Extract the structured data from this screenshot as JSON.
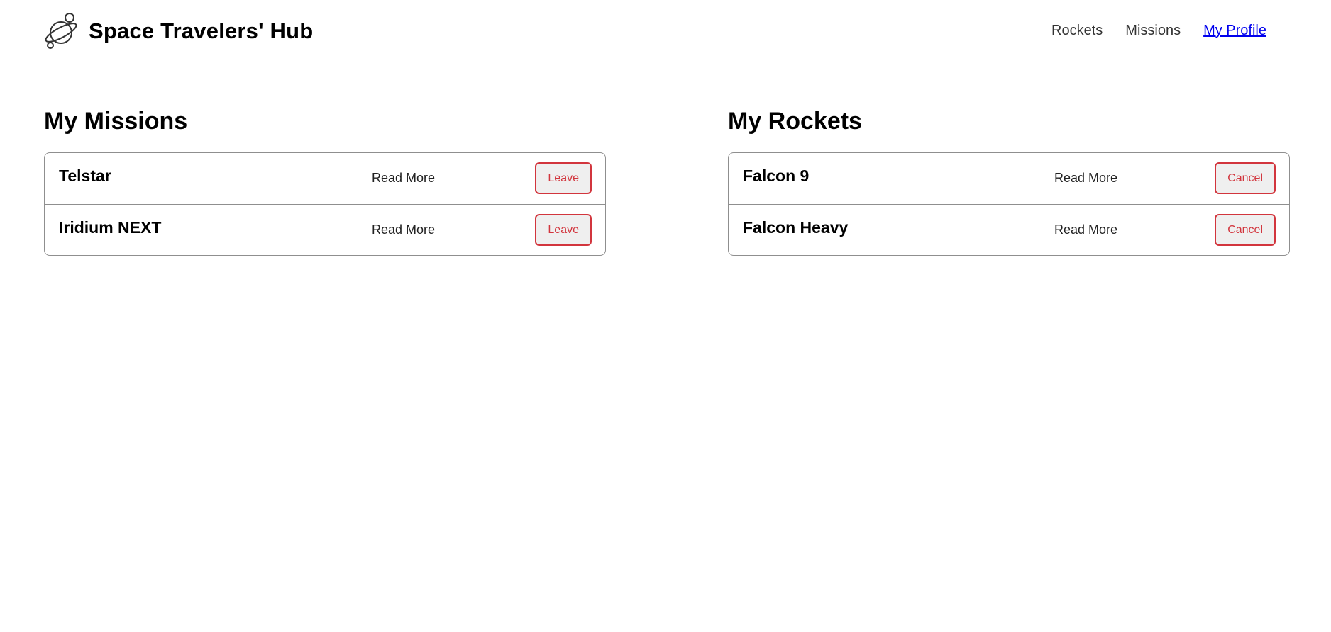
{
  "header": {
    "title": "Space Travelers' Hub",
    "logo_icon": "planet-logo-icon",
    "nav": [
      {
        "label": "Rockets"
      },
      {
        "label": "Missions"
      },
      {
        "label": "My Profile",
        "active": true
      }
    ]
  },
  "missions": {
    "heading": "My Missions",
    "items": [
      {
        "name": "Telstar",
        "read_more": "Read More",
        "action": "Leave"
      },
      {
        "name": "Iridium NEXT",
        "read_more": "Read More",
        "action": "Leave"
      }
    ]
  },
  "rockets": {
    "heading": "My Rockets",
    "items": [
      {
        "name": "Falcon 9",
        "read_more": "Read More",
        "action": "Cancel"
      },
      {
        "name": "Falcon Heavy",
        "read_more": "Read More",
        "action": "Cancel"
      }
    ]
  },
  "colors": {
    "accent_red": "#d2353d",
    "active_link": "#0000ee",
    "divider": "#8a8a8a"
  }
}
